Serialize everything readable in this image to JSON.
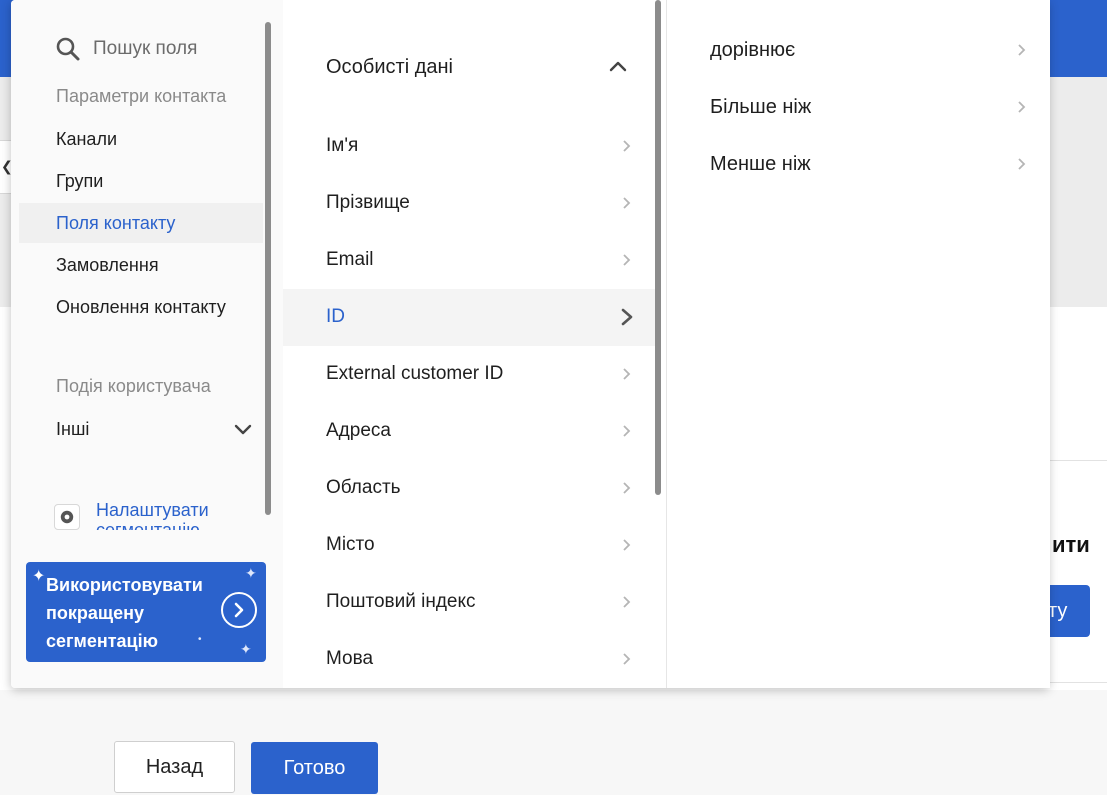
{
  "left_panel": {
    "search_label": "Пошук поля",
    "contact_params_title": "Параметри контакта",
    "contact_items": [
      "Канали",
      "Групи",
      "Поля контакту",
      "Замовлення",
      "Оновлення контакту"
    ],
    "active_contact_item": "Поля контакту",
    "user_event_title": "Подія користувача",
    "others_label": "Інші",
    "settings_label": "Налаштувати сегментацію",
    "promo_label": "Використовувати покращену сегментацію"
  },
  "middle_panel": {
    "header": "Особисті дані",
    "items": [
      "Ім'я",
      "Прізвище",
      "Email",
      "ID",
      "External customer ID",
      "Адреса",
      "Область",
      "Місто",
      "Поштовий індекс",
      "Мова"
    ],
    "active_item": "ID"
  },
  "right_panel": {
    "items": [
      "дорівнює",
      "Більше ніж",
      "Менше ніж"
    ]
  },
  "background": {
    "heading_fragment": "ити",
    "button_fragment": "ту",
    "back_button": "Назад",
    "done_button": "Готово"
  },
  "colors": {
    "accent": "#2b62cc",
    "active_row_bg": "#f4f4f4",
    "muted_text": "#8a8a8a"
  }
}
